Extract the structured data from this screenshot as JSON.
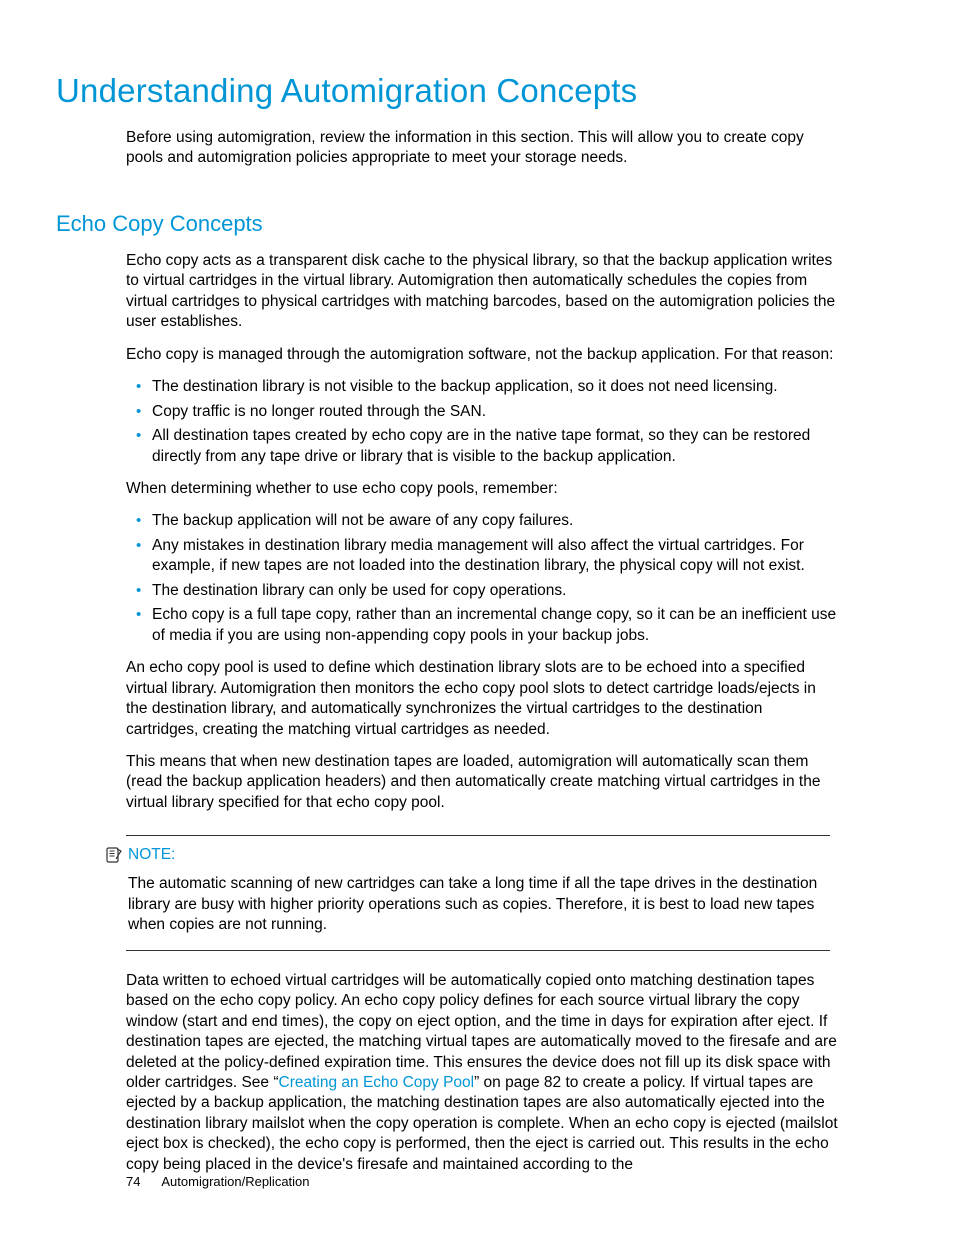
{
  "headings": {
    "h1": "Understanding Automigration Concepts",
    "h2": "Echo Copy Concepts"
  },
  "intro": "Before using automigration, review the information in this section. This will allow you to create copy pools and automigration policies appropriate to meet your storage needs.",
  "p1": "Echo copy acts as a transparent disk cache to the physical library, so that the backup application writes to virtual cartridges in the virtual library. Automigration then automatically schedules the copies from virtual cartridges to physical cartridges with matching barcodes, based on the automigration policies the user establishes.",
  "p2": "Echo copy is managed through the automigration software, not the backup application. For that reason:",
  "list1": {
    "i0": "The destination library is not visible to the backup application, so it does not need licensing.",
    "i1": "Copy traffic is no longer routed through the SAN.",
    "i2": "All destination tapes created by echo copy are in the native tape format, so they can be restored directly from any tape drive or library that is visible to the backup application."
  },
  "p3": "When determining whether to use echo copy pools, remember:",
  "list2": {
    "i0": "The backup application will not be aware of any copy failures.",
    "i1": "Any mistakes in destination library media management will also affect the virtual cartridges. For example, if new tapes are not loaded into the destination library, the physical copy will not exist.",
    "i2": "The destination library can only be used for copy operations.",
    "i3": "Echo copy is a full tape copy, rather than an incremental change copy, so it can be an inefficient use of media if you are using non-appending copy pools in your backup jobs."
  },
  "p4": "An echo copy pool is used to define which destination library slots are to be echoed into a specified virtual library. Automigration then monitors the echo copy pool slots to detect cartridge loads/ejects in the destination library, and automatically synchronizes the virtual cartridges to the destination cartridges, creating the matching virtual cartridges as needed.",
  "p5": "This means that when new destination tapes are loaded, automigration will automatically scan them (read the backup application headers) and then automatically create matching virtual cartridges in the virtual library specified for that echo copy pool.",
  "note": {
    "label": "NOTE:",
    "body": "The automatic scanning of new cartridges can take a long time if all the tape drives in the destination library are busy with higher priority operations such as copies. Therefore, it is best to load new tapes when copies are not running."
  },
  "p6": {
    "pre": "Data written to echoed virtual cartridges will be automatically copied onto matching destination tapes based on the echo copy policy. An echo copy policy defines for each source virtual library the copy window (start and end times), the copy on eject option, and the time in days for expiration after eject. If destination tapes are ejected, the matching virtual tapes are automatically moved to the firesafe and are deleted at the policy-defined expiration time. This ensures the device does not fill up its disk space with older cartridges. See “",
    "link": "Creating an Echo Copy Pool",
    "post": "” on page 82 to create a policy. If virtual tapes are ejected by a backup application, the matching destination tapes are also automatically ejected into the destination library mailslot when the copy operation is complete. When an echo copy is ejected (mailslot eject box is checked), the echo copy is performed, then the eject is carried out. This results in the echo copy being placed in the device's firesafe and maintained according to the"
  },
  "footer": {
    "page": "74",
    "section": "Automigration/Replication"
  }
}
